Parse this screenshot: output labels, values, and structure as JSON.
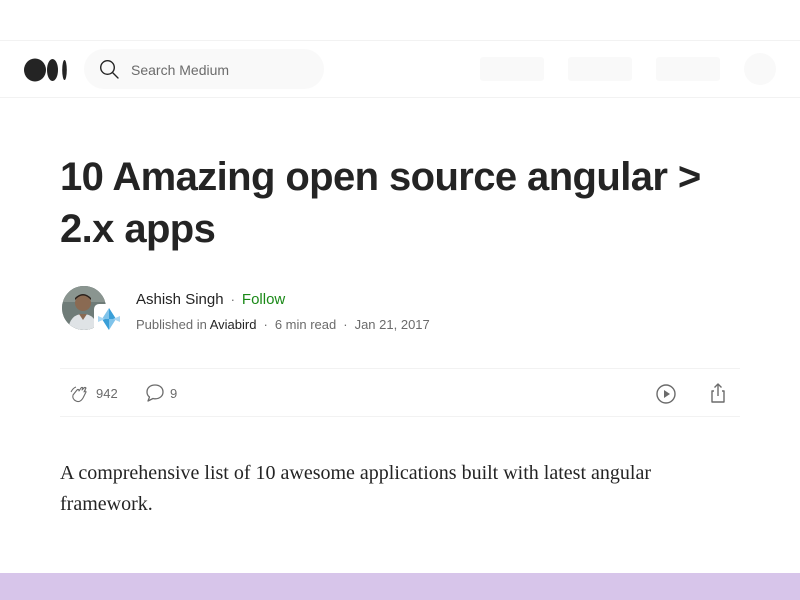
{
  "header": {
    "search_placeholder": "Search Medium"
  },
  "article": {
    "title": "10 Amazing open source angular > 2.x apps",
    "subtitle": "A comprehensive list of 10 awesome applications built with latest angular framework."
  },
  "author": {
    "name": "Ashish Singh",
    "follow_label": "Follow",
    "published_in_label": "Published in",
    "publication": "Aviabird",
    "read_time": "6 min read",
    "date": "Jan 21, 2017"
  },
  "actions": {
    "claps": "942",
    "responses": "9"
  },
  "colors": {
    "follow": "#1a8917",
    "footer_band": "#d7c5ea",
    "text": "#242424",
    "muted": "#6b6b6b"
  },
  "icons": [
    "medium-logo-icon",
    "search-icon",
    "clap-icon",
    "response-icon",
    "play-icon",
    "share-icon"
  ]
}
